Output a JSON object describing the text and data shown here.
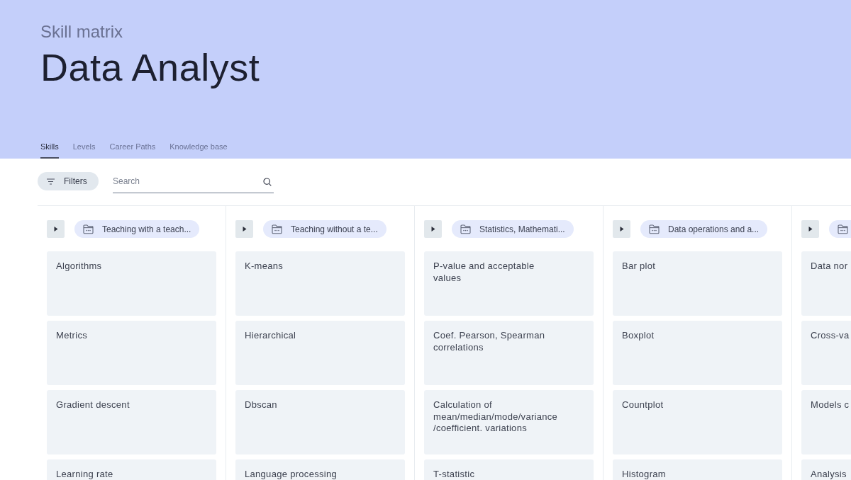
{
  "header": {
    "subtitle": "Skill matrix",
    "title": "Data Analyst"
  },
  "tabs": [
    {
      "label": "Skills",
      "selected": true
    },
    {
      "label": "Levels",
      "selected": false
    },
    {
      "label": "Career Paths",
      "selected": false
    },
    {
      "label": "Knowledge base",
      "selected": false
    }
  ],
  "toolbar": {
    "filters_button": "Filters",
    "search": {
      "placeholder": "Search"
    }
  },
  "columns": [
    {
      "category": "Teaching with a teach...",
      "expanded": false,
      "skills": [
        "Algorithms",
        "Metrics",
        "Gradient descent",
        "Learning rate"
      ]
    },
    {
      "category": "Teaching without a te...",
      "expanded": false,
      "skills": [
        "K-means",
        "Hierarchical",
        "Dbscan",
        "Language processing"
      ]
    },
    {
      "category": "Statistics, Mathemati...",
      "expanded": false,
      "skills": [
        "P-value and acceptable values",
        "Coef. Pearson, Spearman correlations",
        "Calculation of mean/median/mode/variance /coefficient. variations",
        "T-statistic"
      ]
    },
    {
      "category": "Data operations and a...",
      "expanded": false,
      "skills": [
        "Bar plot",
        "Boxplot",
        "Countplot",
        "Histogram"
      ]
    },
    {
      "expanded": false,
      "skills": [
        "Data nor",
        "Cross-va",
        "Models c",
        "Analysis"
      ]
    }
  ]
}
